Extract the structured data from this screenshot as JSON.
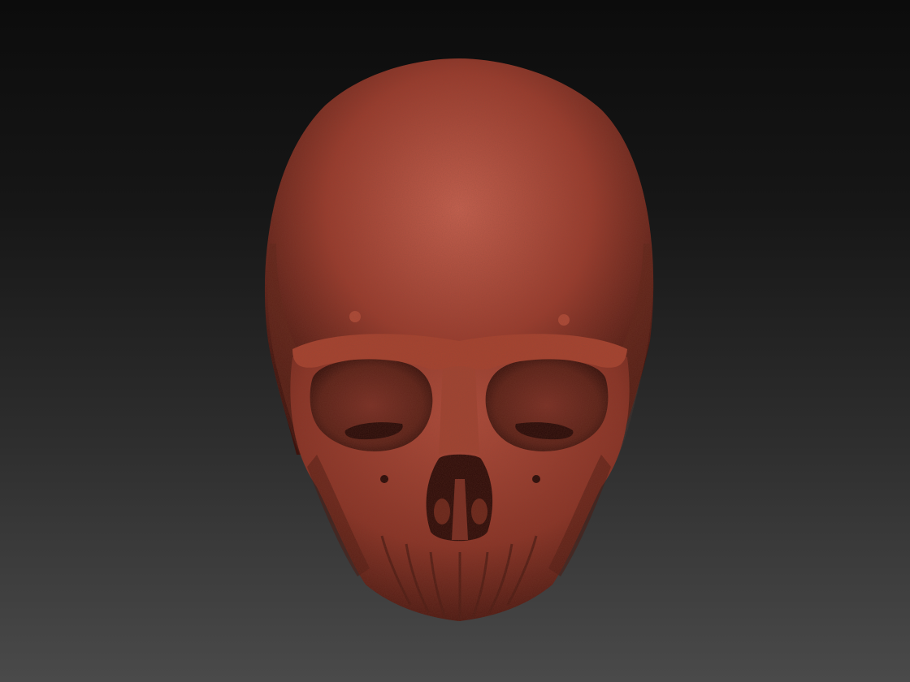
{
  "scene": {
    "subject_icon": "skull-icon",
    "background": {
      "top": "#0c0c0c",
      "bottom": "#4a4a4a"
    },
    "material": {
      "base": "#9a3b2c",
      "highlight": "#c86250",
      "shadow": "#3e130d",
      "cavity": "#5a2117"
    }
  }
}
